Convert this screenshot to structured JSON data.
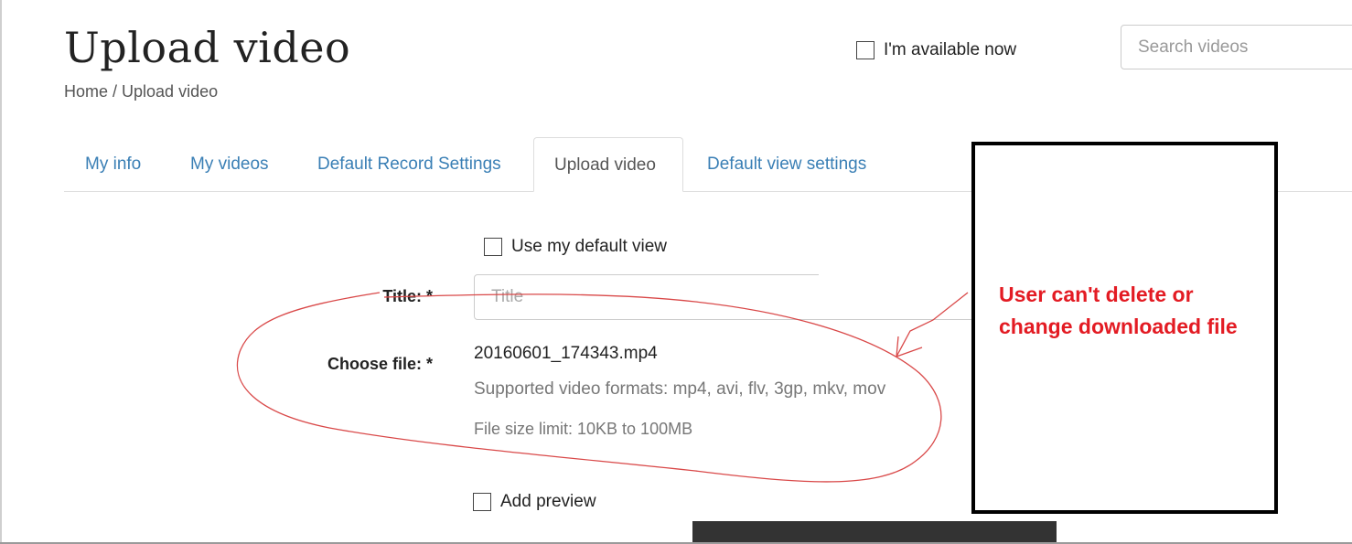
{
  "header": {
    "page_title": "Upload video",
    "breadcrumb": {
      "home": "Home",
      "separator": " / ",
      "current": "Upload video"
    },
    "availability_label": "I'm available now",
    "search_placeholder": "Search videos"
  },
  "tabs": [
    {
      "label": "My info",
      "active": false
    },
    {
      "label": "My videos",
      "active": false
    },
    {
      "label": "Default Record Settings",
      "active": false
    },
    {
      "label": "Upload video",
      "active": true
    },
    {
      "label": "Default view settings",
      "active": false
    }
  ],
  "form": {
    "default_view_label": "Use my default view",
    "title_label": "Title: *",
    "title_placeholder": "Title",
    "file_label": "Choose file: *",
    "file_name": "20160601_174343.mp4",
    "formats_help": "Supported video formats: mp4, avi, flv, 3gp, mkv, mov",
    "size_help": "File size limit: 10KB to 100MB",
    "add_preview_label": "Add preview"
  },
  "annotation": {
    "text": "User can't delete or change downloaded file",
    "text_color": "#e31b23",
    "markup_color": "#d94848"
  },
  "colors": {
    "link": "#3a7fb5",
    "border": "#dddddd"
  }
}
